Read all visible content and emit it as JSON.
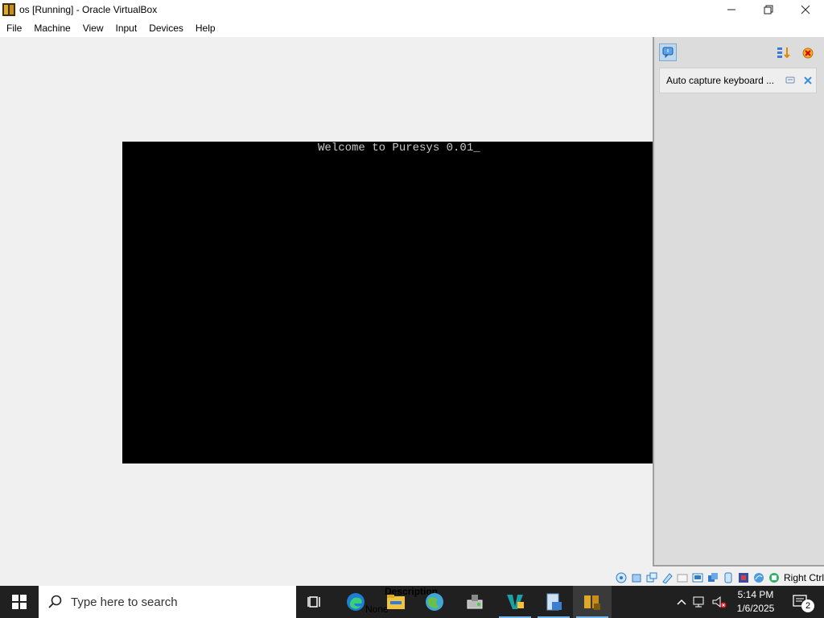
{
  "window": {
    "title": "os [Running] - Oracle VirtualBox"
  },
  "menu": [
    "File",
    "Machine",
    "View",
    "Input",
    "Devices",
    "Help"
  ],
  "vm": {
    "console_text": "Welcome to Puresys 0.01_"
  },
  "notification_center": {
    "message": "Auto capture keyboard ..."
  },
  "statusbar": {
    "host_key": "Right Ctrl"
  },
  "taskbar": {
    "search_placeholder": "Type here to search",
    "bleed_text_1": "Description",
    "bleed_text_2": "None",
    "time": "5:14 PM",
    "date": "1/6/2025",
    "notification_count": "2"
  },
  "colors": {
    "taskbar_bg": "#202020",
    "accent": "#76b9ed",
    "vm_screen": "#000000"
  }
}
